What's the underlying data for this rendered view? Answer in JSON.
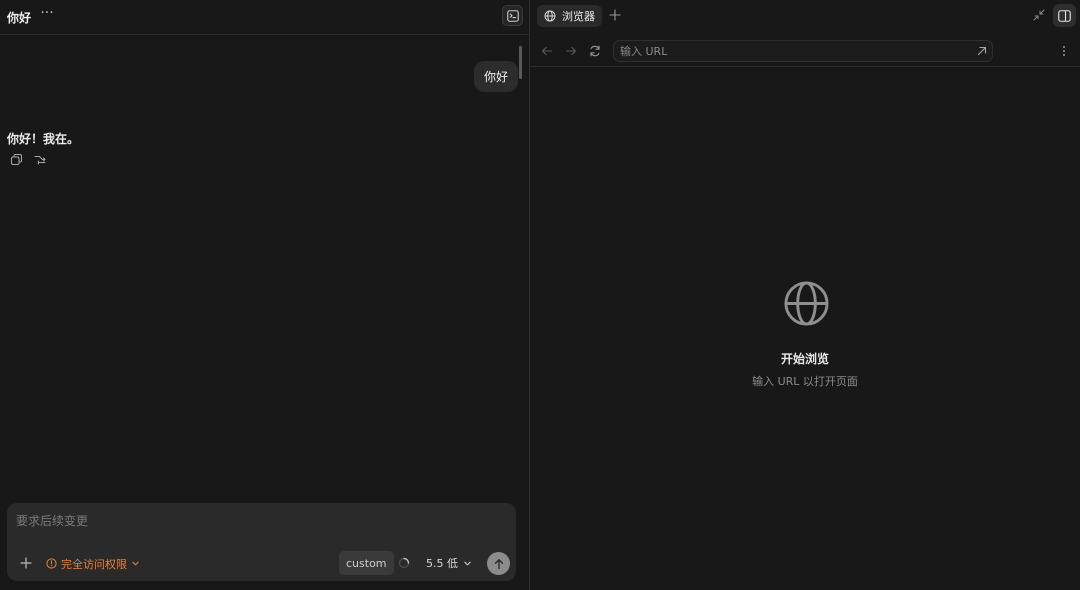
{
  "chat": {
    "title": "你好",
    "more_label": "···",
    "messages": [
      {
        "role": "user",
        "text": "你好"
      },
      {
        "role": "assistant",
        "text": "你好！我在。"
      }
    ],
    "composer": {
      "placeholder": "要求后续变更",
      "access_label": "完全访问权限",
      "custom_label": "custom",
      "model_label": "5.5 低"
    }
  },
  "browser": {
    "tab_label": "浏览器",
    "url_placeholder": "输入 URL",
    "empty_title": "开始浏览",
    "empty_subtitle": "输入 URL 以打开页面"
  },
  "icons": {
    "more": "more-horizontal-icon",
    "terminal": "terminal-icon",
    "copy": "copy-icon",
    "branch": "branch-icon",
    "plus": "plus-icon",
    "warning": "alert-circle-icon",
    "chevron": "chevron-down-icon",
    "spinner": "loading-spinner-icon",
    "send": "arrow-up-icon",
    "globe": "globe-icon",
    "back": "arrow-left-icon",
    "forward": "arrow-right-icon",
    "refresh": "refresh-icon",
    "go": "arrow-up-right-icon",
    "kebab": "more-vertical-icon",
    "collapse": "collapse-icon",
    "sidebar": "sidebar-toggle-icon"
  },
  "colors": {
    "background": "#181818",
    "accent_warning": "#e8803a",
    "send_button": "#8c8c8c"
  }
}
